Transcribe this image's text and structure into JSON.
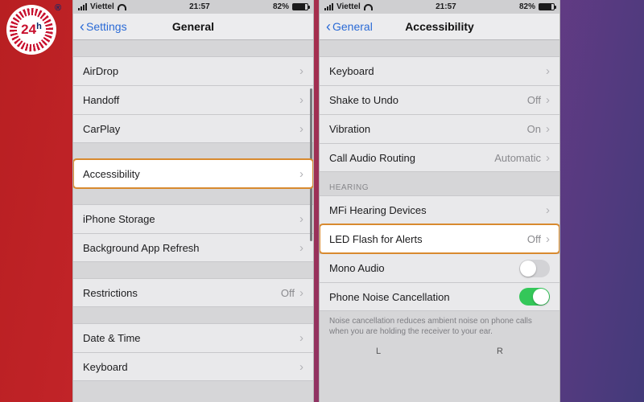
{
  "logo": {
    "text": "24",
    "suffix": "h",
    "reg": "®"
  },
  "status": {
    "carrier": "Viettel",
    "time": "21:57",
    "battery": "82%"
  },
  "left": {
    "back": "Settings",
    "title": "General",
    "rows": {
      "airdrop": "AirDrop",
      "handoff": "Handoff",
      "carplay": "CarPlay",
      "accessibility": "Accessibility",
      "storage": "iPhone Storage",
      "bgrefresh": "Background App Refresh",
      "restrictions": "Restrictions",
      "restrictions_val": "Off",
      "datetime": "Date & Time",
      "keyboard": "Keyboard"
    }
  },
  "right": {
    "back": "General",
    "title": "Accessibility",
    "rows": {
      "keyboard": "Keyboard",
      "shake": "Shake to Undo",
      "shake_val": "Off",
      "vibration": "Vibration",
      "vibration_val": "On",
      "callaudio": "Call Audio Routing",
      "callaudio_val": "Automatic",
      "hearing_header": "HEARING",
      "mfi": "MFi Hearing Devices",
      "ledflash": "LED Flash for Alerts",
      "ledflash_val": "Off",
      "mono": "Mono Audio",
      "noise": "Phone Noise Cancellation",
      "noise_note": "Noise cancellation reduces ambient noise on phone calls when you are holding the receiver to your ear.",
      "L": "L",
      "R": "R"
    }
  }
}
